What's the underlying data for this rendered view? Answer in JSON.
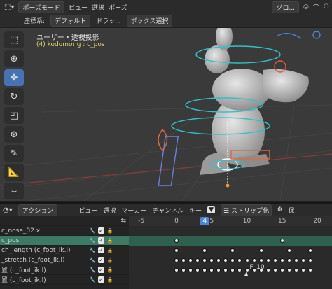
{
  "header": {
    "mode": "ポーズモード",
    "menus": [
      "ビュー",
      "選択",
      "ポーズ"
    ],
    "right_dropdown": "グロ..."
  },
  "header2": {
    "orientation_label": "座標系:",
    "orientation_value": "デフォルト",
    "drag_label": "ドラッ...",
    "select_value": "ボックス選択"
  },
  "viewport": {
    "title": "ユーザー・透視投影",
    "object": "(4) kodomorig : c_pos"
  },
  "toolbar": {
    "tools": [
      "select-box",
      "cursor",
      "move",
      "rotate",
      "scale",
      "transform",
      "annotate",
      "measure",
      "more"
    ]
  },
  "timeline": {
    "mode": "アクション",
    "menus": [
      "ビュー",
      "選択",
      "マーカー",
      "チャンネル",
      "キー"
    ],
    "strip_button": "ストリップ化",
    "save_label": "保",
    "current_frame": "4",
    "marker": "F_10"
  },
  "channels": [
    {
      "name": "c_nose_02.x",
      "selected": false
    },
    {
      "name": "c_pos",
      "selected": true
    },
    {
      "name": "ch_length (c_foot_ik.l)",
      "selected": false
    },
    {
      "name": "_stretch (c_foot_ik.l)",
      "selected": false
    },
    {
      "name": "置 (c_foot_ik.l)",
      "selected": false
    },
    {
      "name": "置 (c_foot_ik.l)",
      "selected": false
    }
  ],
  "chart_data": {
    "ruler_ticks": [
      "-5",
      "0",
      "5",
      "10",
      "15",
      "20"
    ],
    "playhead_frame": 4,
    "keyframes": [
      [
        0,
        15
      ],
      [
        0,
        4,
        8,
        12,
        16,
        19
      ],
      [
        0,
        1,
        2,
        3,
        4,
        5,
        6,
        7,
        8,
        9,
        10,
        11,
        12,
        13,
        14,
        15,
        16,
        17,
        18,
        19
      ],
      [
        0,
        1,
        2,
        3,
        4,
        5,
        6,
        7,
        8,
        9,
        10,
        11,
        12,
        13,
        14,
        15,
        16,
        17,
        18,
        19
      ],
      [],
      []
    ],
    "marker_frame": 10
  }
}
